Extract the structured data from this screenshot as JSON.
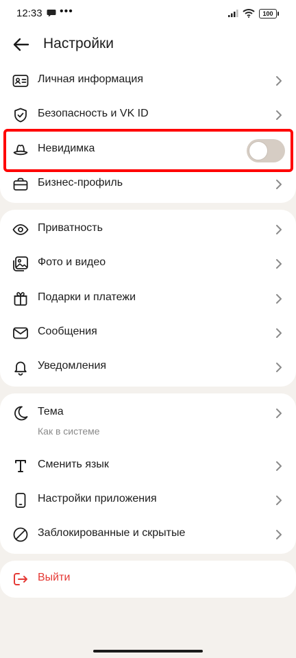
{
  "status": {
    "time": "12:33",
    "dots": "•••",
    "battery": "100"
  },
  "header": {
    "title": "Настройки"
  },
  "groups": {
    "account": [
      {
        "label": "Личная информация"
      },
      {
        "label": "Безопасность и VK ID"
      },
      {
        "label": "Невидимка",
        "toggle_on": false
      },
      {
        "label": "Бизнес-профиль"
      }
    ],
    "content": [
      {
        "label": "Приватность"
      },
      {
        "label": "Фото и видео"
      },
      {
        "label": "Подарки и платежи"
      },
      {
        "label": "Сообщения"
      },
      {
        "label": "Уведомления"
      }
    ],
    "app": [
      {
        "label": "Тема",
        "sublabel": "Как в системе"
      },
      {
        "label": "Сменить язык"
      },
      {
        "label": "Настройки приложения"
      },
      {
        "label": "Заблокированные и скрытые"
      }
    ],
    "logout": {
      "label": "Выйти"
    }
  },
  "colors": {
    "accent_red": "#e53935",
    "highlight": "#ff0000",
    "toggle_off": "#d6cdc4"
  }
}
